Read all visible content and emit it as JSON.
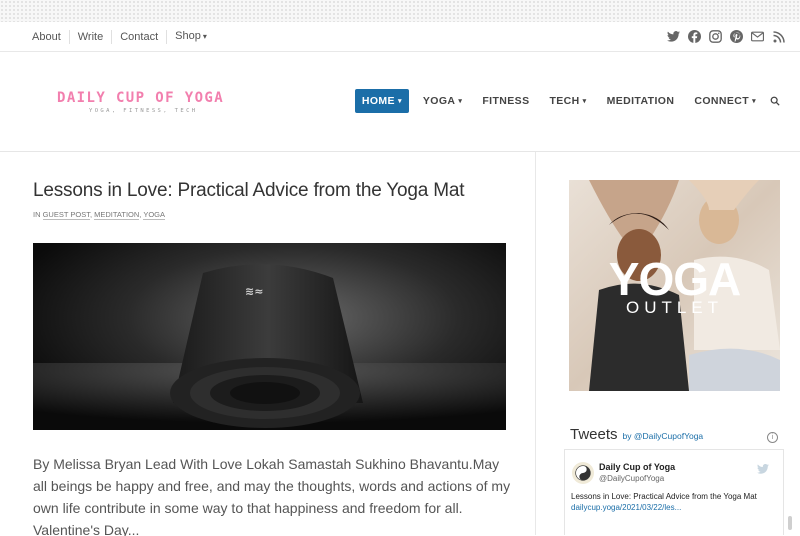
{
  "topnav": {
    "links": [
      "About",
      "Write",
      "Contact",
      "Shop"
    ],
    "social_icons": [
      "twitter-icon",
      "facebook-icon",
      "instagram-icon",
      "pinterest-icon",
      "email-icon",
      "rss-icon"
    ]
  },
  "logo": {
    "title": "DAILY CUP OF YOGA",
    "tagline": "YOGA, FITNESS, TECH",
    "color": "#f27fae"
  },
  "mainnav": {
    "items": [
      "HOME",
      "YOGA",
      "FITNESS",
      "TECH",
      "MEDITATION",
      "CONNECT"
    ],
    "active": "HOME",
    "accent": "#1b6ea8"
  },
  "post": {
    "title": "Lessons in Love: Practical Advice from the Yoga Mat",
    "meta_prefix": "IN",
    "categories": [
      "GUEST POST",
      "MEDITATION",
      "YOGA"
    ],
    "excerpt": "By Melissa Bryan Lead With Love Lokah Samastah Sukhino Bhavantu.May all beings be happy and free, and may the thoughts, words and actions of my own life contribute in some way to that happiness and freedom for all. Valentine's Day..."
  },
  "ad": {
    "brand": "YOGA",
    "sub": "OUTLET"
  },
  "tweets": {
    "heading": "Tweets",
    "by": "by @DailyCupofYoga",
    "name": "Daily Cup of Yoga",
    "handle": "@DailyCupofYoga",
    "text": "Lessons in Love: Practical Advice from the Yoga Mat",
    "link": "dailycup.yoga/2021/03/22/les..."
  }
}
